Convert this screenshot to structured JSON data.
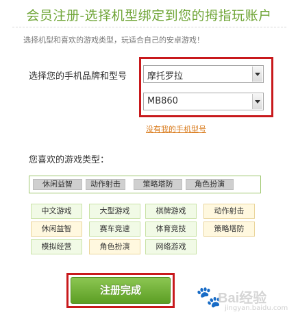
{
  "header": {
    "title": "会员注册-选择机型绑定到您的拇指玩账户",
    "subtitle": "选择机型和喜欢的游戏类型，玩适合自己的安卓游戏！"
  },
  "phone": {
    "label": "选择您的手机品牌和型号",
    "brand_selected": "摩托罗拉",
    "model_selected": "MB860",
    "no_model_link": "没有我的手机型号"
  },
  "genres": {
    "label": "您喜欢的游戏类型：",
    "selected": [
      "休闲益智",
      "动作射击",
      "策略塔防",
      "角色扮演"
    ],
    "options": [
      {
        "label": "中文游戏",
        "tone": "green"
      },
      {
        "label": "大型游戏",
        "tone": "green"
      },
      {
        "label": "棋牌游戏",
        "tone": "green"
      },
      {
        "label": "动作射击",
        "tone": "yellow"
      },
      {
        "label": "休闲益智",
        "tone": "yellow"
      },
      {
        "label": "赛车竞速",
        "tone": "green"
      },
      {
        "label": "体育竞技",
        "tone": "green"
      },
      {
        "label": "策略塔防",
        "tone": "yellow"
      },
      {
        "label": "模拟经营",
        "tone": "green"
      },
      {
        "label": "角色扮演",
        "tone": "yellow"
      },
      {
        "label": "网络游戏",
        "tone": "green"
      }
    ]
  },
  "submit": {
    "label": "注册完成"
  },
  "watermark": {
    "icon": "paw-icon",
    "text": "Bai经验",
    "url": "jingyan.baidu.com"
  },
  "colors": {
    "accent": "#6ea435",
    "highlight": "#c8191c",
    "link": "#d97a1a"
  }
}
